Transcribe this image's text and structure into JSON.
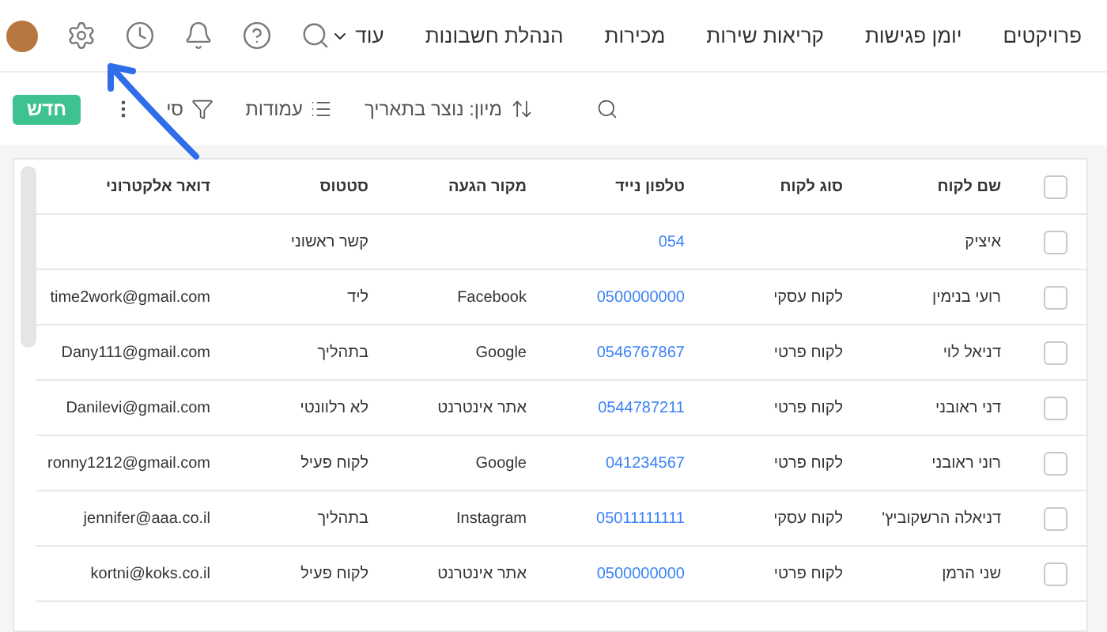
{
  "nav": {
    "items": [
      "פרויקטים",
      "יומן פגישות",
      "קריאות שירות",
      "מכירות",
      "הנהלת חשבונות"
    ],
    "more": "עוד"
  },
  "toolbar": {
    "sort": "מיון: נוצר בתאריך",
    "columns": "עמודות",
    "filter": "סי",
    "new_button": "חדש"
  },
  "table": {
    "header_checked": false,
    "columns": [
      "שם לקוח",
      "סוג לקוח",
      "טלפון נייד",
      "מקור הגעה",
      "סטטוס",
      "דואר אלקטרוני"
    ],
    "rows": [
      {
        "checked": false,
        "cells": [
          "איציק",
          "",
          "054",
          "",
          "קשר ראשוני",
          ""
        ]
      },
      {
        "checked": false,
        "cells": [
          "רועי בנימין",
          "לקוח עסקי",
          "0500000000",
          "Facebook",
          "ליד",
          "time2work@gmail.com"
        ]
      },
      {
        "checked": false,
        "cells": [
          "דניאל לוי",
          "לקוח פרטי",
          "0546767867",
          "Google",
          "בתהליך",
          "Dany111@gmail.com"
        ]
      },
      {
        "checked": false,
        "cells": [
          "דני ראובני",
          "לקוח פרטי",
          "0544787211",
          "אתר אינטרנט",
          "לא רלוונטי",
          "Danilevi@gmail.com"
        ]
      },
      {
        "checked": false,
        "cells": [
          "רוני ראובני",
          "לקוח פרטי",
          "041234567",
          "Google",
          "לקוח פעיל",
          "ronny1212@gmail.com"
        ]
      },
      {
        "checked": false,
        "cells": [
          "דניאלה הרשקוביץ'",
          "לקוח עסקי",
          "05011111111",
          "Instagram",
          "בתהליך",
          "jennifer@aaa.co.il"
        ]
      },
      {
        "checked": false,
        "cells": [
          "שני הרמן",
          "לקוח פרטי",
          "0500000000",
          "אתר אינטרנט",
          "לקוח פעיל",
          "kortni@koks.co.il"
        ]
      }
    ]
  }
}
